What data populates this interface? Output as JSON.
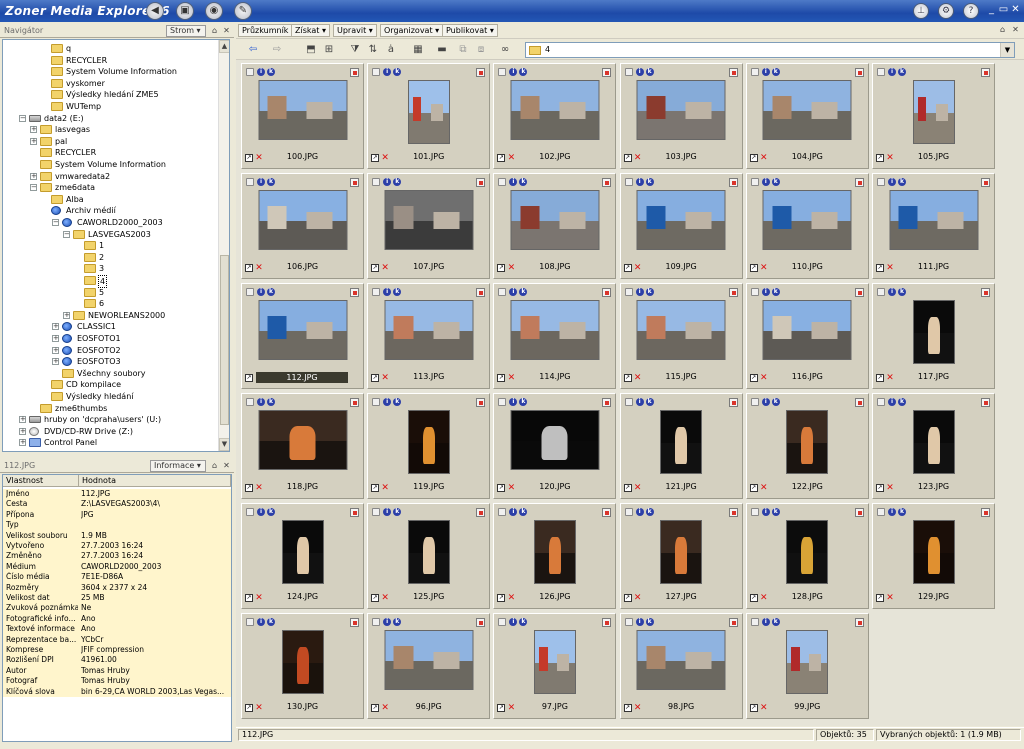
{
  "title": "Zoner Media Explorer 6",
  "colors": {
    "titlebar": "#2357b5",
    "accent": "#2c3fa8",
    "selection": "#3b3a2e",
    "info_bg": "#fff5cc"
  },
  "navigator": {
    "header": "Navigátor",
    "dropdown": "Strom",
    "tree": [
      {
        "label": "q",
        "level": 3,
        "icon": "folder",
        "expander": ""
      },
      {
        "label": "RECYCLER",
        "level": 3,
        "icon": "folder",
        "expander": ""
      },
      {
        "label": "System Volume Information",
        "level": 3,
        "icon": "folder",
        "expander": ""
      },
      {
        "label": "vyskomer",
        "level": 3,
        "icon": "folder",
        "expander": ""
      },
      {
        "label": "Výsledky hledání ZME5",
        "level": 3,
        "icon": "folder",
        "expander": ""
      },
      {
        "label": "WUTemp",
        "level": 3,
        "icon": "folder",
        "expander": ""
      },
      {
        "label": "data2 (E:)",
        "level": 1,
        "icon": "drive",
        "expander": "−"
      },
      {
        "label": "lasvegas",
        "level": 2,
        "icon": "folder",
        "expander": "+"
      },
      {
        "label": "pal",
        "level": 2,
        "icon": "folder",
        "expander": "+"
      },
      {
        "label": "RECYCLER",
        "level": 2,
        "icon": "folder",
        "expander": ""
      },
      {
        "label": "System Volume Information",
        "level": 2,
        "icon": "folder",
        "expander": ""
      },
      {
        "label": "vmwaredata2",
        "level": 2,
        "icon": "folder",
        "expander": "+"
      },
      {
        "label": "zme6data",
        "level": 2,
        "icon": "folder",
        "expander": "−"
      },
      {
        "label": "Alba",
        "level": 3,
        "icon": "folder",
        "expander": ""
      },
      {
        "label": "Archiv médií",
        "level": 3,
        "icon": "globe",
        "expander": ""
      },
      {
        "label": "CAWORLD2000_2003",
        "level": 4,
        "icon": "globe",
        "expander": "−"
      },
      {
        "label": "LASVEGAS2003",
        "level": 5,
        "icon": "folder",
        "expander": "−"
      },
      {
        "label": "1",
        "level": 6,
        "icon": "folder",
        "expander": ""
      },
      {
        "label": "2",
        "level": 6,
        "icon": "folder",
        "expander": ""
      },
      {
        "label": "3",
        "level": 6,
        "icon": "folder",
        "expander": ""
      },
      {
        "label": "4",
        "level": 6,
        "icon": "folder",
        "expander": "",
        "selected": true
      },
      {
        "label": "5",
        "level": 6,
        "icon": "folder",
        "expander": ""
      },
      {
        "label": "6",
        "level": 6,
        "icon": "folder",
        "expander": ""
      },
      {
        "label": "NEWORLEANS2000",
        "level": 5,
        "icon": "folder",
        "expander": "+"
      },
      {
        "label": "CLASSIC1",
        "level": 4,
        "icon": "globe",
        "expander": "+"
      },
      {
        "label": "EOSFOTO1",
        "level": 4,
        "icon": "globe",
        "expander": "+"
      },
      {
        "label": "EOSFOTO2",
        "level": 4,
        "icon": "globe",
        "expander": "+"
      },
      {
        "label": "EOSFOTO3",
        "level": 4,
        "icon": "globe",
        "expander": "+"
      },
      {
        "label": "Všechny soubory",
        "level": 4,
        "icon": "folder",
        "expander": ""
      },
      {
        "label": "CD kompilace",
        "level": 3,
        "icon": "folder",
        "expander": ""
      },
      {
        "label": "Výsledky hledání",
        "level": 3,
        "icon": "folder",
        "expander": ""
      },
      {
        "label": "zme6thumbs",
        "level": 2,
        "icon": "folder",
        "expander": ""
      },
      {
        "label": "hruby on 'dcpraha\\users' (U:)",
        "level": 1,
        "icon": "drive",
        "expander": "+"
      },
      {
        "label": "DVD/CD-RW Drive (Z:)",
        "level": 1,
        "icon": "cd",
        "expander": "+"
      },
      {
        "label": "Control Panel",
        "level": 1,
        "icon": "panel",
        "expander": "+"
      }
    ]
  },
  "info_panel": {
    "header": "112.JPG",
    "dropdown": "Informace",
    "col_property": "Vlastnost",
    "col_value": "Hodnota",
    "rows": [
      {
        "k": "Jméno",
        "v": "112.JPG"
      },
      {
        "k": "Cesta",
        "v": "Z:\\LASVEGAS2003\\4\\"
      },
      {
        "k": "Přípona",
        "v": "JPG"
      },
      {
        "k": "Typ",
        "v": ""
      },
      {
        "k": "Velikost souboru",
        "v": "1.9 MB"
      },
      {
        "k": "Vytvořeno",
        "v": "27.7.2003 16:24"
      },
      {
        "k": "Změněno",
        "v": "27.7.2003 16:24"
      },
      {
        "k": "Médium",
        "v": "CAWORLD2000_2003"
      },
      {
        "k": "Číslo média",
        "v": "7E1E-D86A"
      },
      {
        "k": "Rozměry",
        "v": "3604 x 2377 x 24"
      },
      {
        "k": "Velikost dat",
        "v": "25 MB"
      },
      {
        "k": "Zvuková poznámka",
        "v": "Ne"
      },
      {
        "k": "Fotografické info...",
        "v": "Ano"
      },
      {
        "k": "Textové informace",
        "v": "Ano"
      },
      {
        "k": "Reprezentace ba...",
        "v": "YCbCr"
      },
      {
        "k": "Komprese",
        "v": "JFIF compression"
      },
      {
        "k": "Rozlišení DPI",
        "v": "41961.00"
      },
      {
        "k": "Autor",
        "v": "Tomas Hruby"
      },
      {
        "k": "Fotograf",
        "v": "Tomas Hruby"
      },
      {
        "k": "Klíčová slova",
        "v": "bin 6-29,CA WORLD 2003,Las Vegas..."
      }
    ]
  },
  "menus": [
    "Průzkumník",
    "Získat",
    "Upravit",
    "Organizovat",
    "Publikovat"
  ],
  "path": "4",
  "thumbnails": [
    {
      "name": "100.JPG",
      "scene": "street",
      "orient": "l"
    },
    {
      "name": "101.JPG",
      "scene": "sign",
      "orient": "p"
    },
    {
      "name": "102.JPG",
      "scene": "street",
      "orient": "l"
    },
    {
      "name": "103.JPG",
      "scene": "building",
      "orient": "l"
    },
    {
      "name": "104.JPG",
      "scene": "street",
      "orient": "l"
    },
    {
      "name": "105.JPG",
      "scene": "flag",
      "orient": "p"
    },
    {
      "name": "106.JPG",
      "scene": "city",
      "orient": "l"
    },
    {
      "name": "107.JPG",
      "scene": "highway",
      "orient": "l"
    },
    {
      "name": "108.JPG",
      "scene": "building",
      "orient": "l"
    },
    {
      "name": "109.JPG",
      "scene": "truck",
      "orient": "l"
    },
    {
      "name": "110.JPG",
      "scene": "truck",
      "orient": "l"
    },
    {
      "name": "111.JPG",
      "scene": "truck",
      "orient": "l"
    },
    {
      "name": "112.JPG",
      "scene": "truck",
      "orient": "l",
      "selected": true
    },
    {
      "name": "113.JPG",
      "scene": "coaster",
      "orient": "l"
    },
    {
      "name": "114.JPG",
      "scene": "coaster",
      "orient": "l"
    },
    {
      "name": "115.JPG",
      "scene": "coaster",
      "orient": "l"
    },
    {
      "name": "116.JPG",
      "scene": "city",
      "orient": "l"
    },
    {
      "name": "117.JPG",
      "scene": "dancer",
      "orient": "p"
    },
    {
      "name": "118.JPG",
      "scene": "party",
      "orient": "l"
    },
    {
      "name": "119.JPG",
      "scene": "night",
      "orient": "p"
    },
    {
      "name": "120.JPG",
      "scene": "dark",
      "orient": "l"
    },
    {
      "name": "121.JPG",
      "scene": "dancer",
      "orient": "p"
    },
    {
      "name": "122.JPG",
      "scene": "party",
      "orient": "p"
    },
    {
      "name": "123.JPG",
      "scene": "dancer",
      "orient": "p"
    },
    {
      "name": "124.JPG",
      "scene": "dancer",
      "orient": "p"
    },
    {
      "name": "125.JPG",
      "scene": "dancer",
      "orient": "p"
    },
    {
      "name": "126.JPG",
      "scene": "party",
      "orient": "p"
    },
    {
      "name": "127.JPG",
      "scene": "party",
      "orient": "p"
    },
    {
      "name": "128.JPG",
      "scene": "palm",
      "orient": "p"
    },
    {
      "name": "129.JPG",
      "scene": "night",
      "orient": "p"
    },
    {
      "name": "130.JPG",
      "scene": "mask",
      "orient": "p"
    },
    {
      "name": "96.JPG",
      "scene": "street",
      "orient": "l"
    },
    {
      "name": "97.JPG",
      "scene": "sign",
      "orient": "p"
    },
    {
      "name": "98.JPG",
      "scene": "street",
      "orient": "l"
    },
    {
      "name": "99.JPG",
      "scene": "flag",
      "orient": "p"
    }
  ],
  "status": {
    "selected_file": "112.JPG",
    "objects": "Objektů: 35",
    "selected_objects": "Vybraných objektů: 1 (1.9 MB)"
  }
}
